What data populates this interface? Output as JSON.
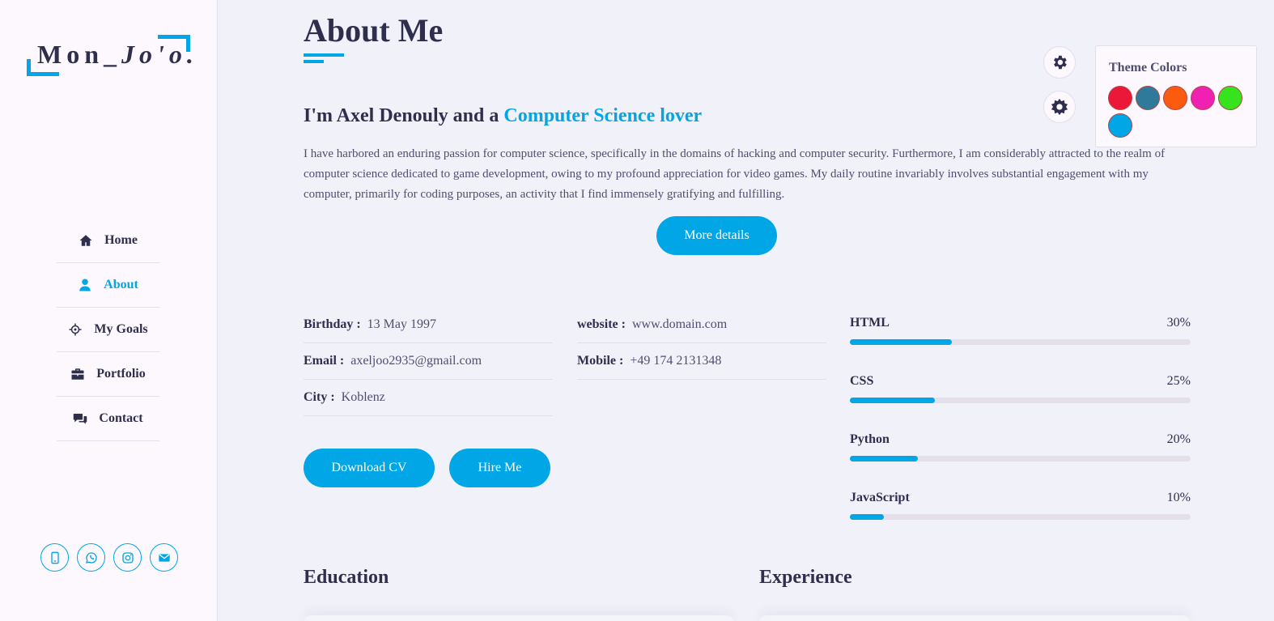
{
  "logo": {
    "part1": "Mon_",
    "part2": "Jo'o."
  },
  "nav": [
    {
      "label": "Home",
      "icon": "home-icon",
      "active": false
    },
    {
      "label": "About",
      "icon": "user-icon",
      "active": true
    },
    {
      "label": "My Goals",
      "icon": "target-icon",
      "active": false
    },
    {
      "label": "Portfolio",
      "icon": "briefcase-icon",
      "active": false
    },
    {
      "label": "Contact",
      "icon": "chat-icon",
      "active": false
    }
  ],
  "socials": [
    "phone-icon",
    "whatsapp-icon",
    "instagram-icon",
    "mail-icon"
  ],
  "about": {
    "title": "About Me",
    "intro_prefix": "I'm Axel Denouly and a ",
    "intro_highlight": "Computer Science lover",
    "paragraph": "I have harbored an enduring passion for computer science, specifically in the domains of hacking and computer security. Furthermore, I am considerably attracted to the realm of computer science dedicated to game development, owing to my profound appreciation for video games. My daily routine invariably involves substantial engagement with my computer, primarily for coding purposes, an activity that I find immensely gratifying and fulfilling.",
    "more_button": "More details"
  },
  "info_left": [
    {
      "label": "Birthday :",
      "value": "13 May 1997"
    },
    {
      "label": "Email :",
      "value": "axeljoo2935@gmail.com"
    },
    {
      "label": "City :",
      "value": "Koblenz"
    }
  ],
  "info_right": [
    {
      "label": "website :",
      "value": "www.domain.com"
    },
    {
      "label": "Mobile :",
      "value": "+49 174 2131348"
    }
  ],
  "buttons": {
    "download": "Download CV",
    "hire": "Hire Me"
  },
  "skills": [
    {
      "name": "HTML",
      "percent_label": "30%",
      "percent": 30
    },
    {
      "name": "CSS",
      "percent_label": "25%",
      "percent": 25
    },
    {
      "name": "Python",
      "percent_label": "20%",
      "percent": 20
    },
    {
      "name": "JavaScript",
      "percent_label": "10%",
      "percent": 10
    }
  ],
  "sections": {
    "education": "Education",
    "experience": "Experience"
  },
  "theme": {
    "title": "Theme Colors",
    "colors": [
      "#ec1839",
      "#2f7a9a",
      "#fa5b0f",
      "#f021b2",
      "#37e31c",
      "#00a6e6"
    ]
  },
  "accent_color": "#00a6e6"
}
